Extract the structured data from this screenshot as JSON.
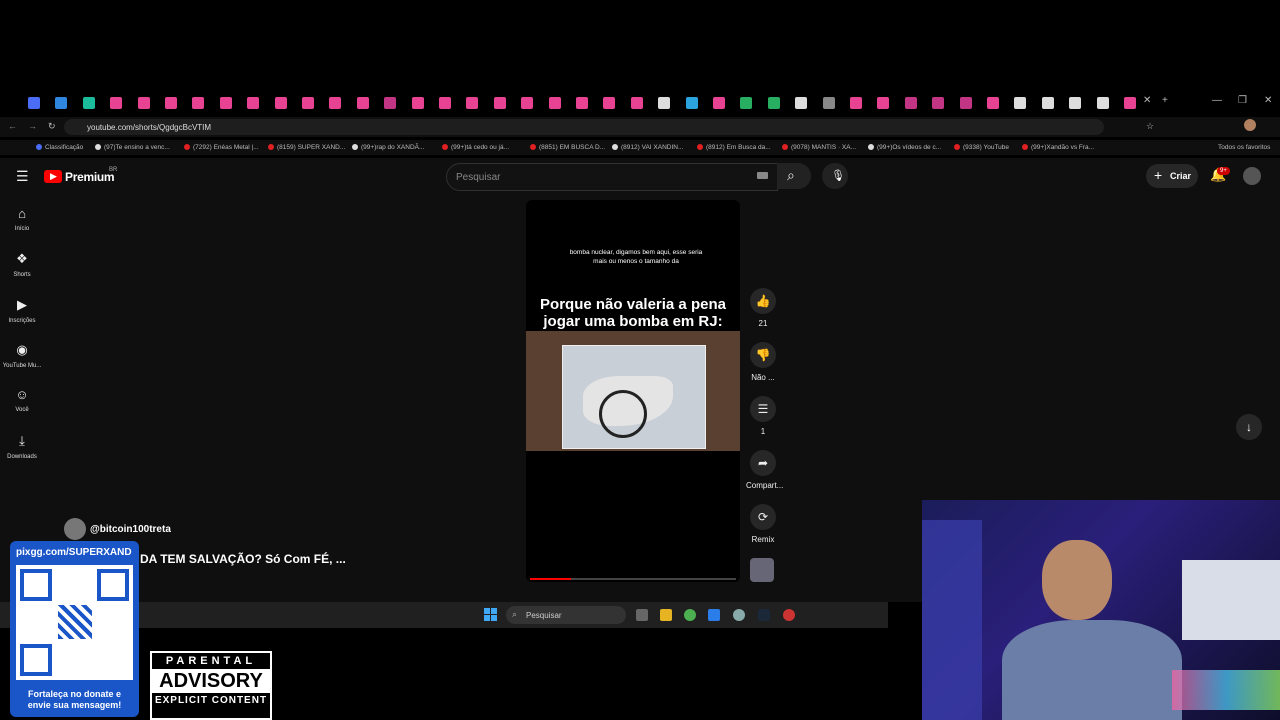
{
  "browser": {
    "url": "youtube.com/shorts/QgdgcBcVTIM",
    "bookmarks": [
      "Classificação",
      "(97)Te ensino a venc...",
      "(7292) Enéas Metal |...",
      "(8159) SUPER XAND...",
      "(99+)rap do XANDÃ...",
      "(99+)tá cedo ou já...",
      "(8851) EM BUSCA D...",
      "(8912) VAI XANDIN...",
      "(8912) Em Busca da...",
      "(9078) MANTIS · XA...",
      "(99+)Os vídeos de c...",
      "(9338) YouTube",
      "(99+)Xandão vs Fra..."
    ],
    "all_favorites": "Todos os favoritos"
  },
  "youtube": {
    "logo": "Premium",
    "logo_region": "BR",
    "search_placeholder": "Pesquisar",
    "create_label": "Criar",
    "notification_badge": "9+",
    "sidebar": [
      {
        "label": "Início",
        "icon": "home-icon",
        "glyph": "⌂"
      },
      {
        "label": "Shorts",
        "icon": "shorts-icon",
        "glyph": "❖"
      },
      {
        "label": "Inscrições",
        "icon": "subscriptions-icon",
        "glyph": "▶"
      },
      {
        "label": "YouTube Mu...",
        "icon": "youtube-music-icon",
        "glyph": "◉"
      },
      {
        "label": "Você",
        "icon": "you-icon",
        "glyph": "☺"
      },
      {
        "label": "Downloads",
        "icon": "download-icon",
        "glyph": "⤓"
      }
    ],
    "short": {
      "caption": "bomba nuclear, digamos bem aqui, esse seria mais ou menos o tamanho da",
      "title_overlay": "Porque não valeria a pena jogar uma bomba em RJ:",
      "channel": "@bitcoin100treta",
      "video_title": "DA TEM SALVAÇÃO? Só Com FÉ, ..."
    },
    "actions": [
      {
        "label": "21",
        "icon": "like-icon",
        "glyph": "👍"
      },
      {
        "label": "Não ...",
        "icon": "dislike-icon",
        "glyph": "👎"
      },
      {
        "label": "1",
        "icon": "comment-icon",
        "glyph": "☰"
      },
      {
        "label": "Compart...",
        "icon": "share-icon",
        "glyph": "➦"
      },
      {
        "label": "Remix",
        "icon": "remix-icon",
        "glyph": "⟳"
      }
    ]
  },
  "taskbar": {
    "search": "Pesquisar"
  },
  "overlay": {
    "qr_title": "pixgg.com/SUPERXAND",
    "qr_caption": "Fortaleça no donate e envie sua mensagem!",
    "advisory_top": "PARENTAL",
    "advisory_mid": "ADVISORY",
    "advisory_bottom": "EXPLICIT CONTENT"
  }
}
